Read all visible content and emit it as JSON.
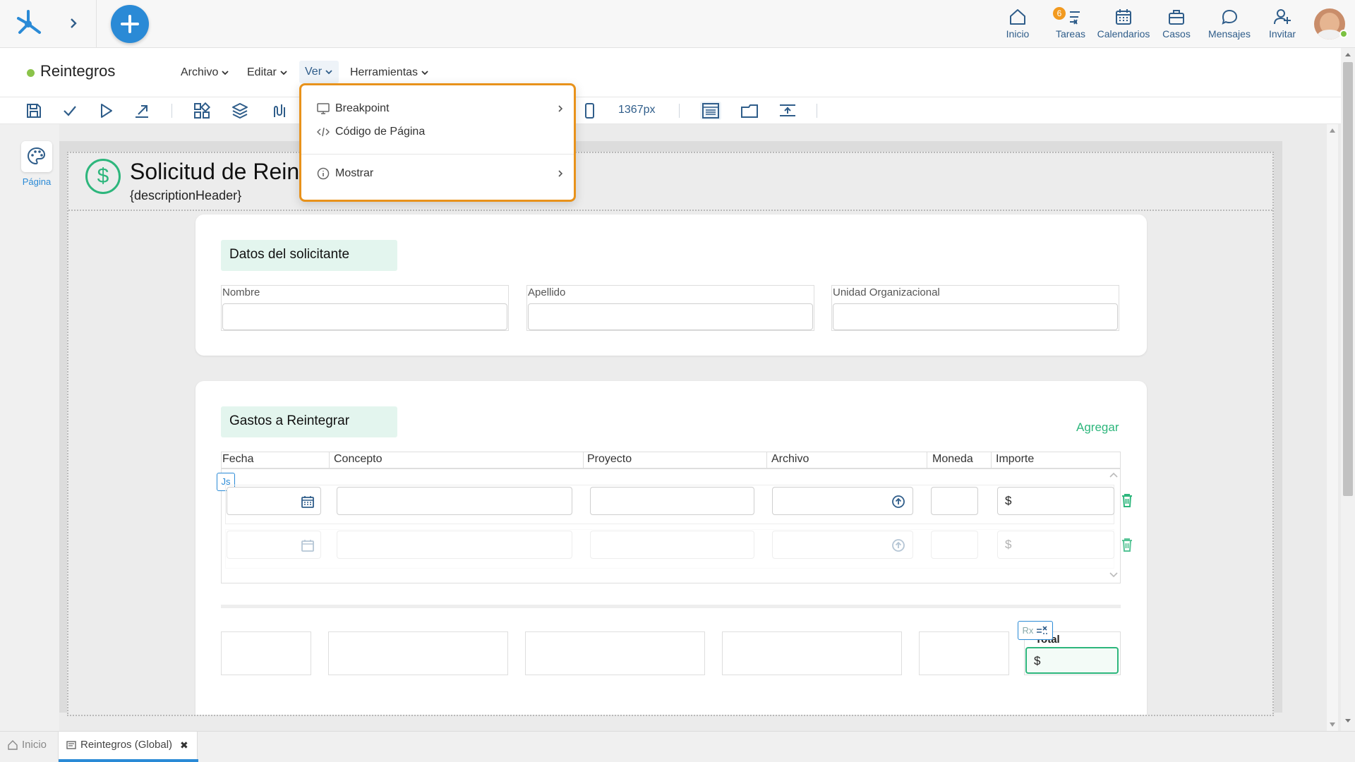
{
  "topbar": {
    "nav": [
      {
        "label": "Inicio",
        "icon": "home-icon"
      },
      {
        "label": "Tareas",
        "icon": "tasks-icon",
        "badge": "6"
      },
      {
        "label": "Calendarios",
        "icon": "calendar-icon"
      },
      {
        "label": "Casos",
        "icon": "briefcase-icon"
      },
      {
        "label": "Mensajes",
        "icon": "chat-icon"
      },
      {
        "label": "Invitar",
        "icon": "add-user-icon"
      }
    ],
    "colors": {
      "brand": "#2a8ad6",
      "accent_green": "#2db67c",
      "badge": "#f29a1f"
    }
  },
  "document": {
    "title": "Reintegros",
    "menus": [
      "Archivo",
      "Editar",
      "Ver",
      "Herramientas"
    ]
  },
  "toolbar": {
    "width_label": "1367px"
  },
  "left_panel": {
    "page_label": "Página"
  },
  "dropdown": {
    "items": [
      {
        "label": "Breakpoint",
        "icon": "monitor-icon",
        "has_submenu": true
      },
      {
        "label": "Código de Página",
        "icon": "code-icon",
        "has_submenu": false
      },
      {
        "label": "Mostrar",
        "icon": "info-icon",
        "has_submenu": true
      }
    ]
  },
  "form": {
    "title": "Solicitud de Rein",
    "subtitle": "{descriptionHeader}",
    "applicant": {
      "heading": "Datos del solicitante",
      "fields": [
        "Nombre",
        "Apellido",
        "Unidad Organizacional"
      ]
    },
    "expenses": {
      "heading": "Gastos a Reintegrar",
      "add_label": "Agregar",
      "columns": [
        "Fecha",
        "Concepto",
        "Proyecto",
        "Archivo",
        "Moneda",
        "Importe"
      ],
      "currency_symbol": "$",
      "js_badge": "Js",
      "rx_badge": "Rx",
      "total_label": "Total",
      "total_currency": "$"
    }
  },
  "bottom_tabs": [
    {
      "label": "Inicio",
      "active": false
    },
    {
      "label": "Reintegros (Global)",
      "active": true,
      "close": "✖"
    }
  ]
}
